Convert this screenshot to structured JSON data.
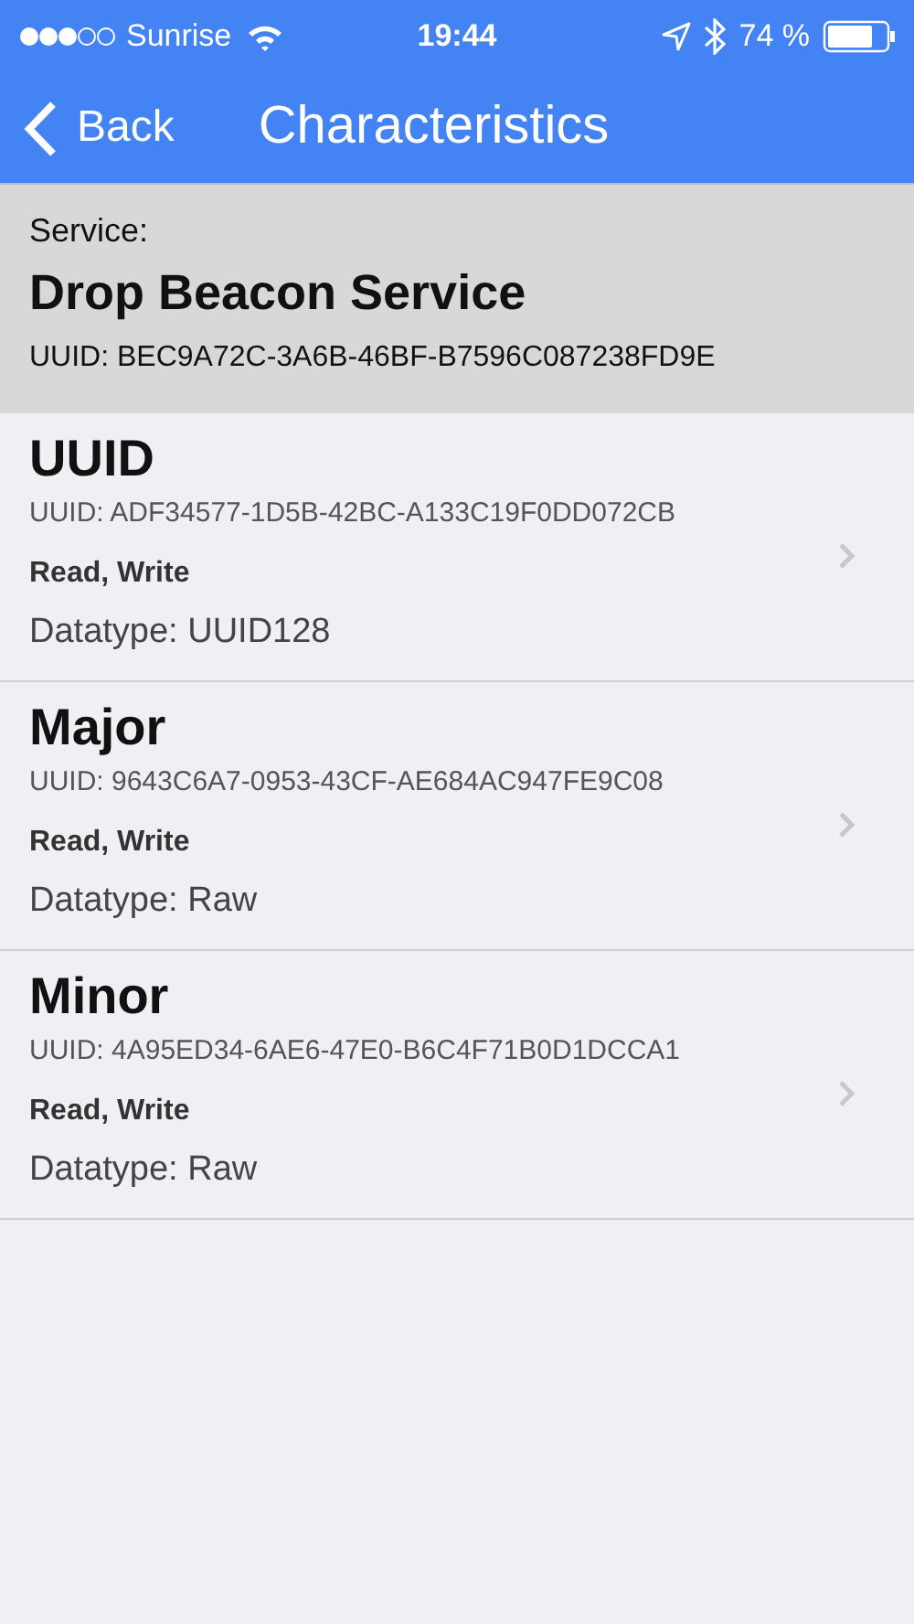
{
  "status_bar": {
    "carrier": "Sunrise",
    "time": "19:44",
    "battery": "74 %"
  },
  "nav": {
    "back": "Back",
    "title": "Characteristics"
  },
  "service": {
    "label": "Service:",
    "name": "Drop Beacon Service",
    "uuid": "UUID: BEC9A72C-3A6B-46BF-B7596C087238FD9E"
  },
  "characteristics": [
    {
      "name": "UUID",
      "uuid": "UUID: ADF34577-1D5B-42BC-A133C19F0DD072CB",
      "properties": "Read, Write",
      "datatype": "Datatype: UUID128"
    },
    {
      "name": "Major",
      "uuid": "UUID: 9643C6A7-0953-43CF-AE684AC947FE9C08",
      "properties": "Read, Write",
      "datatype": "Datatype: Raw"
    },
    {
      "name": "Minor",
      "uuid": "UUID: 4A95ED34-6AE6-47E0-B6C4F71B0D1DCCA1",
      "properties": "Read, Write",
      "datatype": "Datatype: Raw"
    }
  ]
}
